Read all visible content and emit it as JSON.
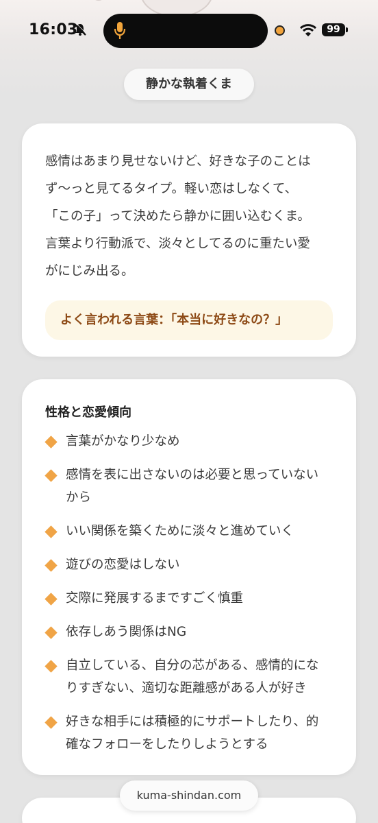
{
  "status_bar": {
    "time": "16:03",
    "battery": "99",
    "icons": [
      "bell-off-icon",
      "microphone-icon",
      "recording-dot-icon",
      "wifi-icon",
      "battery-icon"
    ]
  },
  "colors": {
    "accent_orange": "#f0a446",
    "quote_bg": "#fdf7e6",
    "quote_text": "#8d4a16",
    "page_bg": "#e4e4e4"
  },
  "type_chip": {
    "label": "静かな執着くま"
  },
  "description": {
    "text": "感情はあまり見せないけど、好きな子のことは\nず〜っと見てるタイプ。軽い恋はしなくて、\n「この子」って決めたら静かに囲い込むくま。\n言葉より行動派で、淡々としてるのに重たい愛\nがにじみ出る。",
    "quote": "よく言われる言葉：「本当に好きなの？」"
  },
  "traits": {
    "title": "性格と恋愛傾向",
    "items": [
      "言葉がかなり少なめ",
      "感情を表に出さないのは必要と思っていない\nから",
      "いい関係を築くために淡々と進めていく",
      "遊びの恋愛はしない",
      "交際に発展するまですごく慎重",
      "依存しあう関係はNG",
      "自立している、自分の芯がある、感情的にな\nりすぎない、適切な距離感がある人が好き",
      "好きな相手には積極的にサポートしたり、的\n確なフォローをしたりしようとする"
    ]
  },
  "footer": {
    "url": "kuma-shindan.com"
  }
}
